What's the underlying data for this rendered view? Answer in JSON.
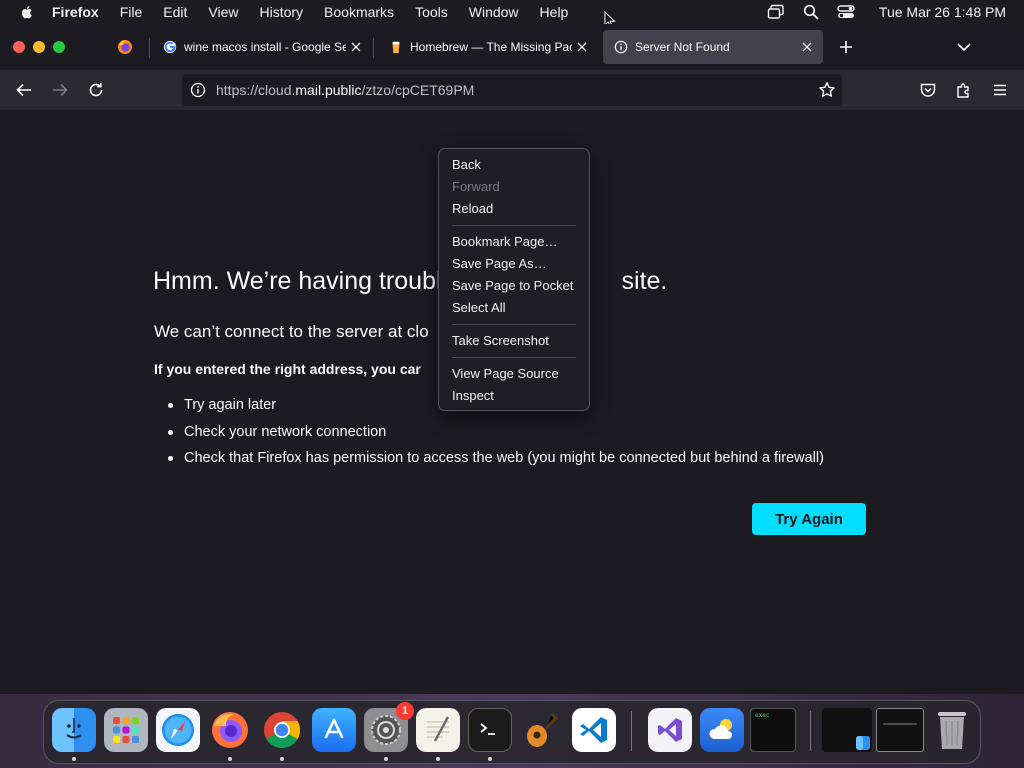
{
  "menubar": {
    "app_name": "Firefox",
    "menus": [
      "File",
      "Edit",
      "View",
      "History",
      "Bookmarks",
      "Tools",
      "Window",
      "Help"
    ],
    "clock": "Tue Mar 26  1:48 PM"
  },
  "tabs": [
    {
      "title": "wine macos install - Google Search",
      "icon": "google-icon"
    },
    {
      "title": "Homebrew — The Missing Package Manager",
      "icon": "homebrew-icon"
    },
    {
      "title": "Server Not Found",
      "icon": "info-icon",
      "active": true
    }
  ],
  "url": {
    "scheme": "https://cloud.",
    "host": "mail.public",
    "path": "/ztzo/cpCET69PM"
  },
  "error": {
    "title_visible": "Hmm. We’re having troubl",
    "title_tail": "site.",
    "short_visible": "We can’t connect to the server at clo",
    "advice_visible": "If you entered the right address, you car",
    "suggestions": [
      "Try again later",
      "Check your network connection",
      "Check that Firefox has permission to access the web (you might be connected but behind a firewall)"
    ],
    "try_again": "Try Again"
  },
  "context_menu": {
    "groups": [
      [
        {
          "label": "Back"
        },
        {
          "label": "Forward",
          "disabled": true
        },
        {
          "label": "Reload"
        }
      ],
      [
        {
          "label": "Bookmark Page…"
        },
        {
          "label": "Save Page As…"
        },
        {
          "label": "Save Page to Pocket"
        },
        {
          "label": "Select All"
        }
      ],
      [
        {
          "label": "Take Screenshot"
        }
      ],
      [
        {
          "label": "View Page Source"
        },
        {
          "label": "Inspect"
        }
      ]
    ]
  },
  "dock": {
    "apps": [
      "finder",
      "launchpad",
      "safari",
      "firefox",
      "chrome",
      "app-store",
      "system-settings",
      "textedit",
      "terminal",
      "garageband",
      "vscode",
      "visual-studio",
      "weather",
      "exec-terminal"
    ],
    "settings_badge": "1",
    "exec_label": "exec"
  },
  "colors": {
    "accent": "#00ddff",
    "page_bg": "#1c1b22",
    "active_tab": "#42414d"
  }
}
